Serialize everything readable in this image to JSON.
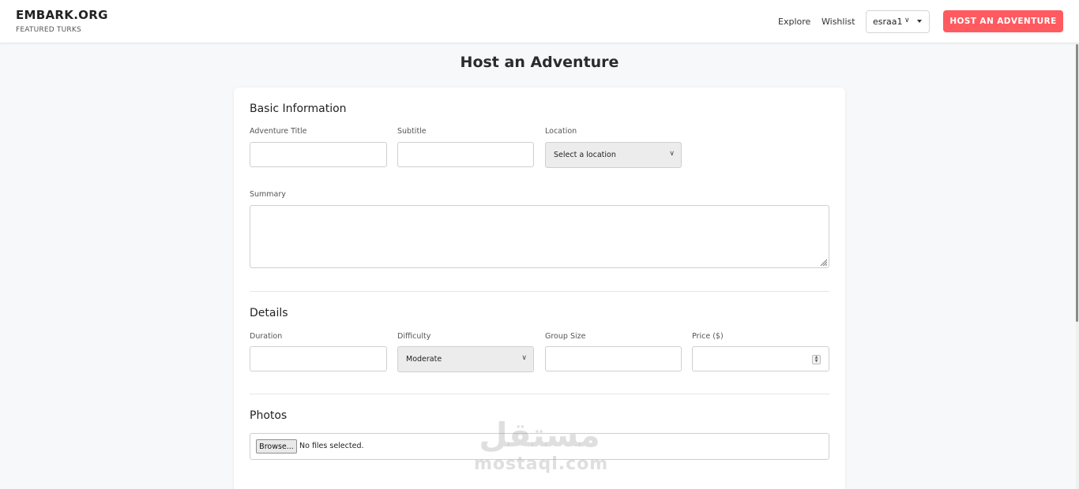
{
  "header": {
    "brand": "EMBARK.ORG",
    "tagline": "FEATURED TURKS",
    "nav": {
      "explore": "Explore",
      "wishlist": "Wishlist"
    },
    "user": {
      "name": "esraa1"
    },
    "host_button": "HOST AN ADVENTURE",
    "accent_color": "#ff5a5f"
  },
  "page": {
    "title": "Host an Adventure"
  },
  "form": {
    "basic": {
      "title": "Basic Information",
      "adventure_title_label": "Adventure Title",
      "subtitle_label": "Subtitle",
      "location_label": "Location",
      "location_value": "Select a location",
      "summary_label": "Summary"
    },
    "details": {
      "title": "Details",
      "duration_label": "Duration",
      "difficulty_label": "Difficulty",
      "difficulty_value": "Moderate",
      "group_size_label": "Group Size",
      "price_label": "Price ($)"
    },
    "photos": {
      "title": "Photos",
      "browse_label": "Browse...",
      "file_status": "No files selected."
    }
  },
  "watermark": {
    "arabic": "مستقل",
    "latin": "mostaql.com"
  }
}
